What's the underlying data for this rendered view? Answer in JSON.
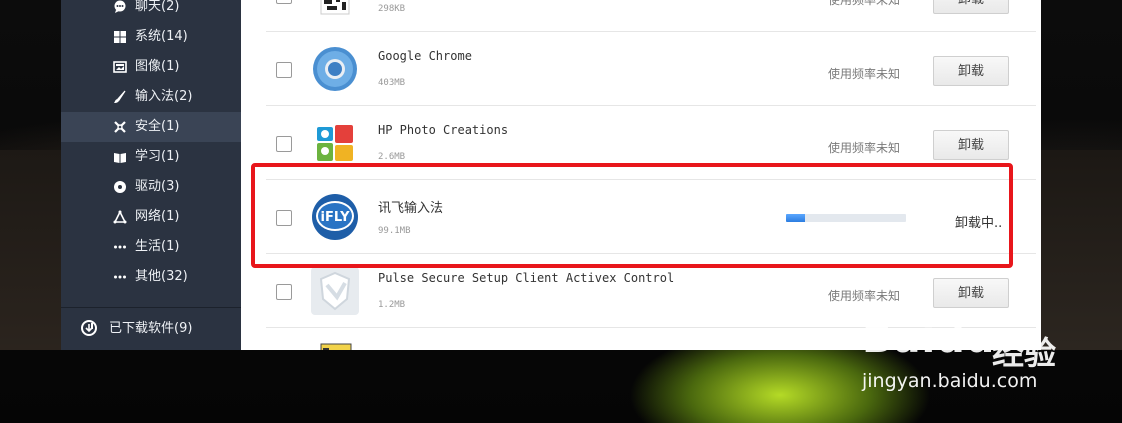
{
  "sidebar": {
    "categories": [
      {
        "label": "聊天(2)",
        "icon": "chat-icon"
      },
      {
        "label": "系统(14)",
        "icon": "windows-icon"
      },
      {
        "label": "图像(1)",
        "icon": "image-icon"
      },
      {
        "label": "输入法(2)",
        "icon": "brush-icon"
      },
      {
        "label": "安全(1)",
        "icon": "security-icon"
      },
      {
        "label": "学习(1)",
        "icon": "book-icon"
      },
      {
        "label": "驱动(3)",
        "icon": "disc-icon"
      },
      {
        "label": "网络(1)",
        "icon": "network-icon"
      },
      {
        "label": "生活(1)",
        "icon": "dots-icon"
      },
      {
        "label": "其他(32)",
        "icon": "dots-icon"
      }
    ],
    "active_category": "安全(1)",
    "downloads_label": "已下载软件(9)"
  },
  "apps": [
    {
      "name": "",
      "size": "298KB",
      "frequency": "使用频率未知",
      "button": "卸载"
    },
    {
      "name": "Google Chrome",
      "size": "403MB",
      "frequency": "使用频率未知",
      "button": "卸载"
    },
    {
      "name": "HP Photo Creations",
      "size": "2.6MB",
      "frequency": "使用频率未知",
      "button": "卸载"
    },
    {
      "name": "讯飞输入法",
      "size": "99.1MB",
      "status": "卸载中..",
      "progress": 0.16
    },
    {
      "name": "Pulse Secure Setup Client Activex Control",
      "size": "1.2MB",
      "frequency": "使用频率未知",
      "button": "卸载"
    }
  ],
  "watermark": {
    "logo": "Baidu",
    "brand_cn": "经验",
    "url": "jingyan.baidu.com"
  },
  "colors": {
    "sidebar_bg": "#2b3341",
    "highlight_border": "#e8161b",
    "progress": "#2c7de0"
  }
}
